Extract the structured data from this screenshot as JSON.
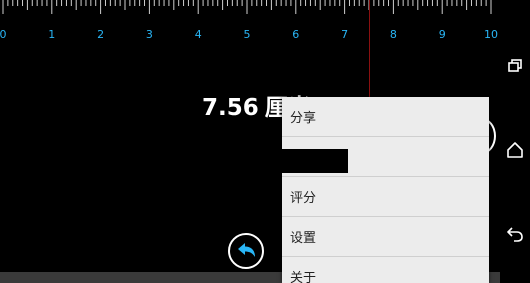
{
  "ruler": {
    "labels": [
      "0",
      "1",
      "2",
      "3",
      "4",
      "5",
      "6",
      "7",
      "8",
      "9",
      "10"
    ],
    "label_color": "#29b6f6",
    "cursor_color": "#8a1010"
  },
  "measurement": {
    "value": "7.56",
    "unit": "厘米"
  },
  "menu": {
    "items": [
      {
        "label": "分享"
      },
      {
        "label": ""
      },
      {
        "label": "评分"
      },
      {
        "label": "设置"
      },
      {
        "label": "关于"
      }
    ]
  },
  "icons": {
    "undo": "undo-arrow-icon",
    "recent_apps": "recent-apps-icon",
    "home": "home-icon",
    "back": "back-icon"
  },
  "colors": {
    "accent": "#29b6f6",
    "menu_bg": "#ececec",
    "background": "#000000"
  }
}
